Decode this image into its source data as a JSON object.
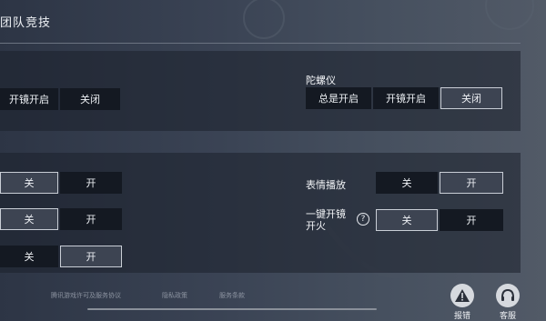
{
  "header": {
    "mode_title": "团队竞技"
  },
  "gyro": {
    "label": "陀螺仪",
    "options": [
      "总是开启",
      "开镜开启",
      "关闭"
    ],
    "selected": 2
  },
  "left_top_row": {
    "options": [
      "开镜开启",
      "关闭"
    ]
  },
  "left_rows": [
    {
      "off": "关",
      "on": "开",
      "selected": "on"
    },
    {
      "off": "关",
      "on": "开",
      "selected": "on"
    },
    {
      "off": "关",
      "on": "开",
      "selected": "on"
    }
  ],
  "emote": {
    "label": "表情播放",
    "off": "关",
    "on": "开",
    "selected": "on"
  },
  "oneclick": {
    "label_line1": "一键开镜",
    "label_line2": "开火",
    "help": "?",
    "off": "关",
    "on": "开",
    "selected": "off"
  },
  "footer": {
    "links": [
      "腾讯游戏许可及服务协议",
      "隐私政策",
      "服务条款"
    ],
    "report_label": "报错",
    "service_label": "客服"
  }
}
